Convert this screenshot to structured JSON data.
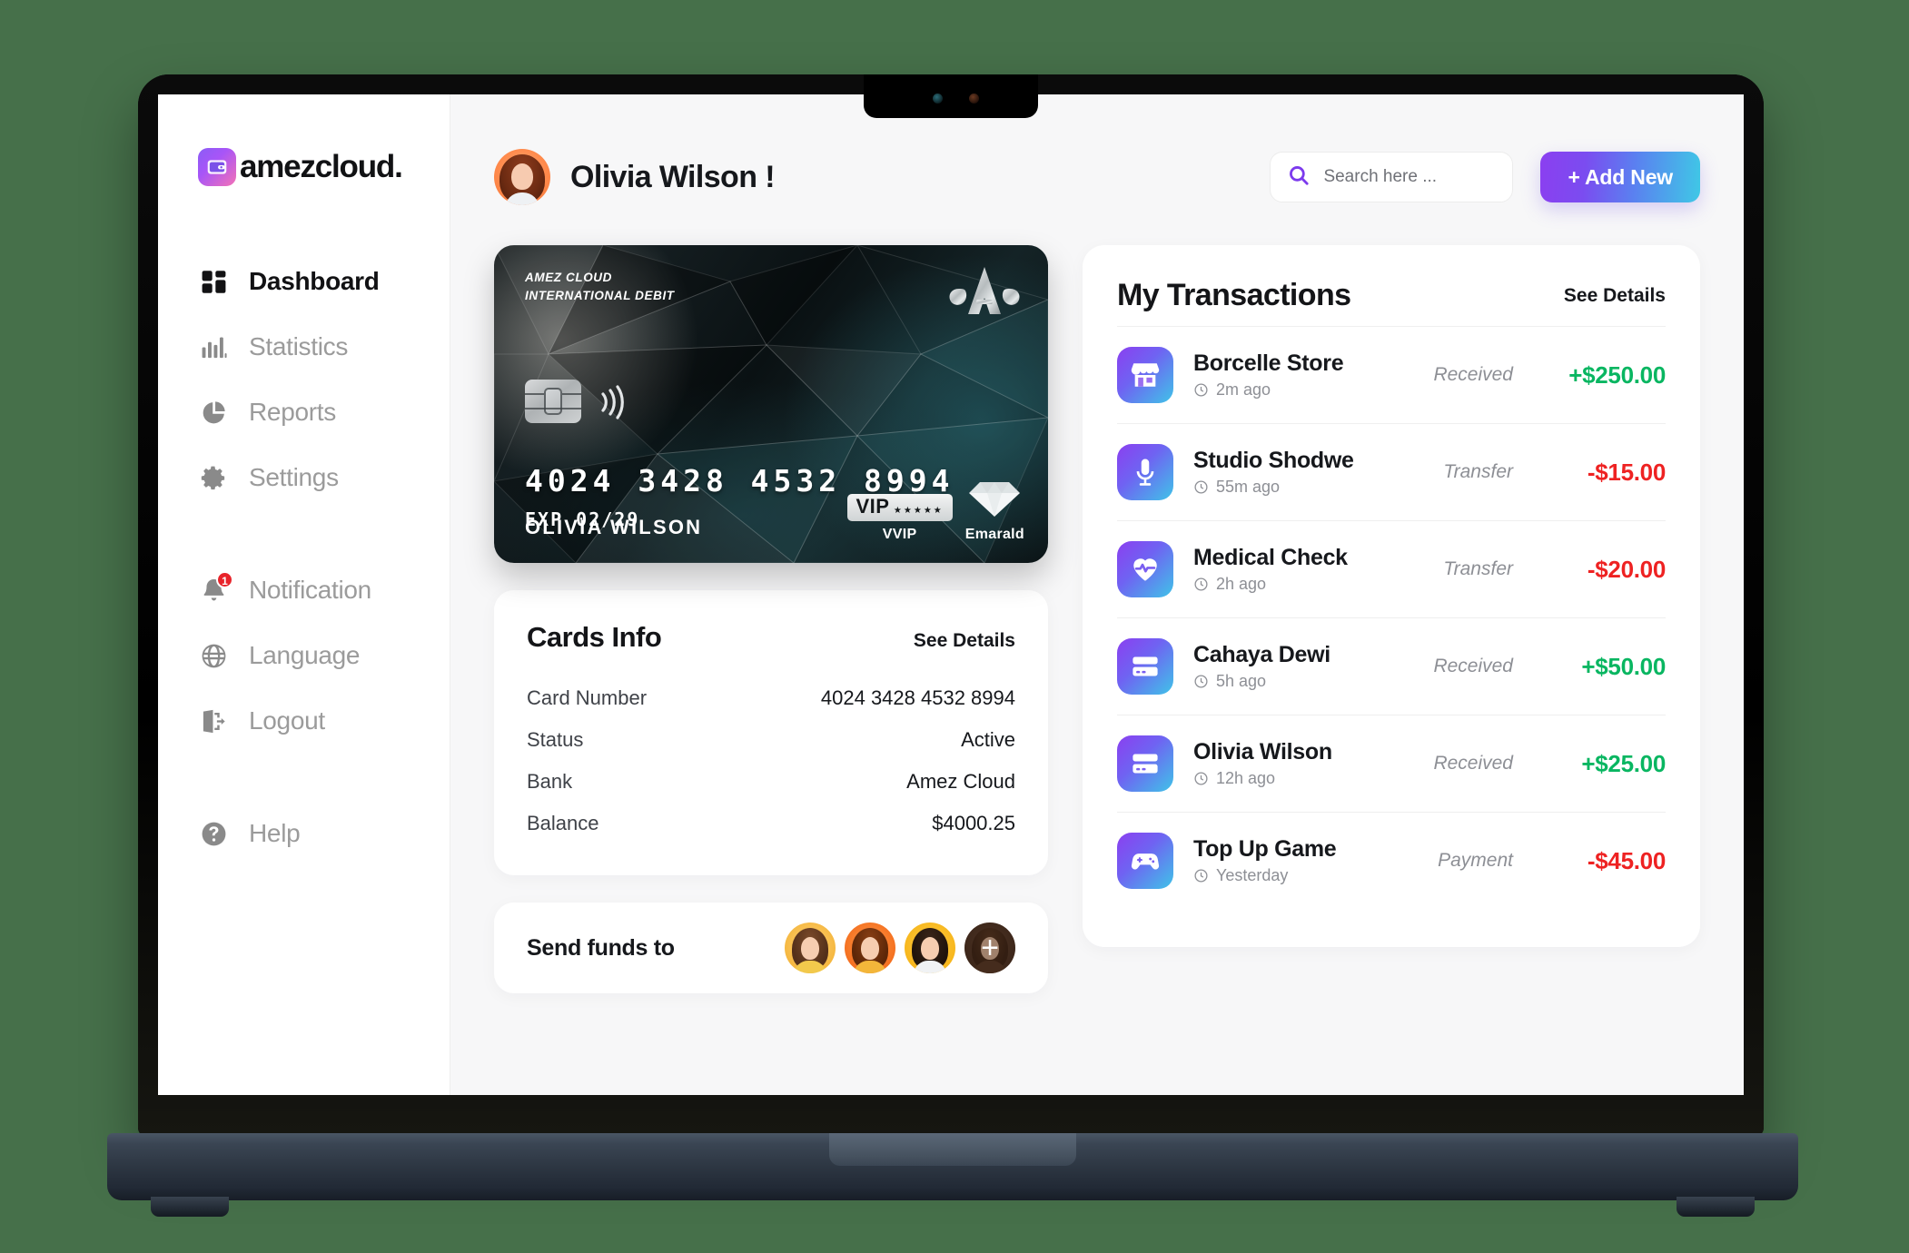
{
  "theme": {
    "background": "#46704A",
    "accent_start": "#8B3FF0",
    "accent_end": "#3FC8E6",
    "positive": "#09B661",
    "negative": "#EE2222"
  },
  "sidebar": {
    "logo_text": "amezcloud.",
    "items": [
      {
        "label": "Dashboard",
        "icon": "grid-icon",
        "active": true
      },
      {
        "label": "Statistics",
        "icon": "bar-chart-icon",
        "active": false
      },
      {
        "label": "Reports",
        "icon": "pie-chart-icon",
        "active": false
      },
      {
        "label": "Settings",
        "icon": "gear-icon",
        "active": false
      }
    ],
    "items2": [
      {
        "label": "Notification",
        "icon": "bell-icon",
        "badge": "1"
      },
      {
        "label": "Language",
        "icon": "globe-icon",
        "badge": ""
      },
      {
        "label": "Logout",
        "icon": "logout-icon",
        "badge": ""
      }
    ],
    "help": {
      "label": "Help",
      "icon": "help-circle-icon"
    }
  },
  "header": {
    "greeting": "Olivia Wilson !",
    "search": {
      "placeholder": "Search here ...",
      "value": ""
    },
    "add_button": "+ Add New"
  },
  "credit_card": {
    "brand_line1": "AMEZ CLOUD",
    "brand_line2": "INTERNATIONAL DEBIT",
    "number": "4024 3428 4532 8994",
    "exp": "EXP 02/29",
    "holder": "OLIVIA WILSON",
    "vip_text": "VIP",
    "vip_stars": "★★★★★",
    "vip_label": "VVIP",
    "gem_label": "Emarald"
  },
  "cards_info": {
    "title": "Cards Info",
    "see_details": "See Details",
    "rows": [
      {
        "key": "Card Number",
        "value": "4024 3428 4532 8994"
      },
      {
        "key": "Status",
        "value": "Active"
      },
      {
        "key": "Bank",
        "value": "Amez Cloud"
      },
      {
        "key": "Balance",
        "value": "$4000.25"
      }
    ]
  },
  "send_funds": {
    "label": "Send funds to",
    "contacts": [
      {
        "name": "contact-1"
      },
      {
        "name": "contact-2"
      },
      {
        "name": "contact-3"
      },
      {
        "name": "add-contact",
        "plus": "+"
      }
    ]
  },
  "transactions": {
    "title": "My Transactions",
    "see_details": "See Details",
    "rows": [
      {
        "icon": "store-icon",
        "name": "Borcelle Store",
        "time": "2m ago",
        "type": "Received",
        "amount": "+$250.00",
        "sign": "pos"
      },
      {
        "icon": "microphone-icon",
        "name": "Studio Shodwe",
        "time": "55m ago",
        "type": "Transfer",
        "amount": "-$15.00",
        "sign": "neg"
      },
      {
        "icon": "heart-pulse-icon",
        "name": "Medical Check",
        "time": "2h ago",
        "type": "Transfer",
        "amount": "-$20.00",
        "sign": "neg"
      },
      {
        "icon": "credit-card-icon",
        "name": "Cahaya Dewi",
        "time": "5h ago",
        "type": "Received",
        "amount": "+$50.00",
        "sign": "pos"
      },
      {
        "icon": "credit-card-icon",
        "name": "Olivia Wilson",
        "time": "12h ago",
        "type": "Received",
        "amount": "+$25.00",
        "sign": "pos"
      },
      {
        "icon": "gamepad-icon",
        "name": "Top Up Game",
        "time": "Yesterday",
        "type": "Payment",
        "amount": "-$45.00",
        "sign": "neg"
      }
    ]
  }
}
